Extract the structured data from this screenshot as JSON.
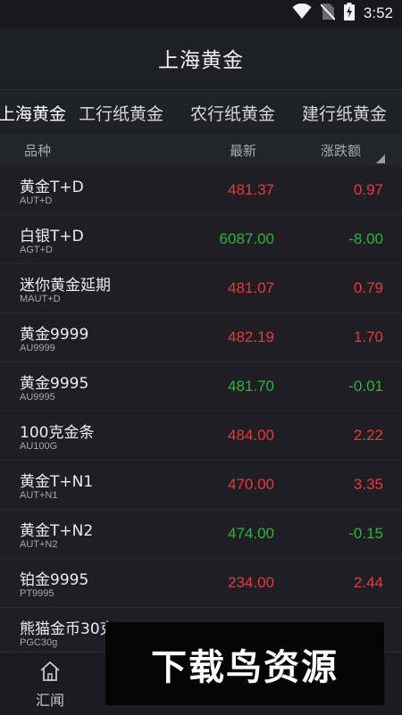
{
  "status_bar": {
    "time": "3:52",
    "icons": [
      "wifi-icon",
      "no-sim-icon",
      "battery-charging-icon"
    ]
  },
  "header": {
    "title": "上海黄金"
  },
  "tabs": [
    {
      "label": "上海黄金",
      "active": true
    },
    {
      "label": "工行纸黄金",
      "active": false
    },
    {
      "label": "农行纸黄金",
      "active": false
    },
    {
      "label": "建行纸黄金",
      "active": false
    }
  ],
  "columns": {
    "name": "品种",
    "latest": "最新",
    "change": "涨跌额"
  },
  "colors": {
    "up": "#e53a3a",
    "down": "#2fb33a",
    "background": "#1c1c22"
  },
  "rows": [
    {
      "name": "黄金T+D",
      "code": "AUT+D",
      "price": "481.37",
      "change": "0.97",
      "direction": "up"
    },
    {
      "name": "白银T+D",
      "code": "AGT+D",
      "price": "6087.00",
      "change": "-8.00",
      "direction": "down"
    },
    {
      "name": "迷你黄金延期",
      "code": "MAUT+D",
      "price": "481.07",
      "change": "0.79",
      "direction": "up"
    },
    {
      "name": "黄金9999",
      "code": "AU9999",
      "price": "482.19",
      "change": "1.70",
      "direction": "up"
    },
    {
      "name": "黄金9995",
      "code": "AU9995",
      "price": "481.70",
      "change": "-0.01",
      "direction": "down"
    },
    {
      "name": "100克金条",
      "code": "AU100G",
      "price": "484.00",
      "change": "2.22",
      "direction": "up"
    },
    {
      "name": "黄金T+N1",
      "code": "AUT+N1",
      "price": "470.00",
      "change": "3.35",
      "direction": "up"
    },
    {
      "name": "黄金T+N2",
      "code": "AUT+N2",
      "price": "474.00",
      "change": "-0.15",
      "direction": "down"
    },
    {
      "name": "铂金9995",
      "code": "PT9995",
      "price": "234.00",
      "change": "2.44",
      "direction": "up"
    },
    {
      "name": "熊猫金币30克",
      "code": "PGC30g",
      "price": "",
      "change": "",
      "direction": "up"
    }
  ],
  "bottom_nav": {
    "items": [
      {
        "label": "汇闻",
        "icon": "home-icon"
      }
    ]
  },
  "watermark": {
    "text": "下载鸟资源"
  }
}
